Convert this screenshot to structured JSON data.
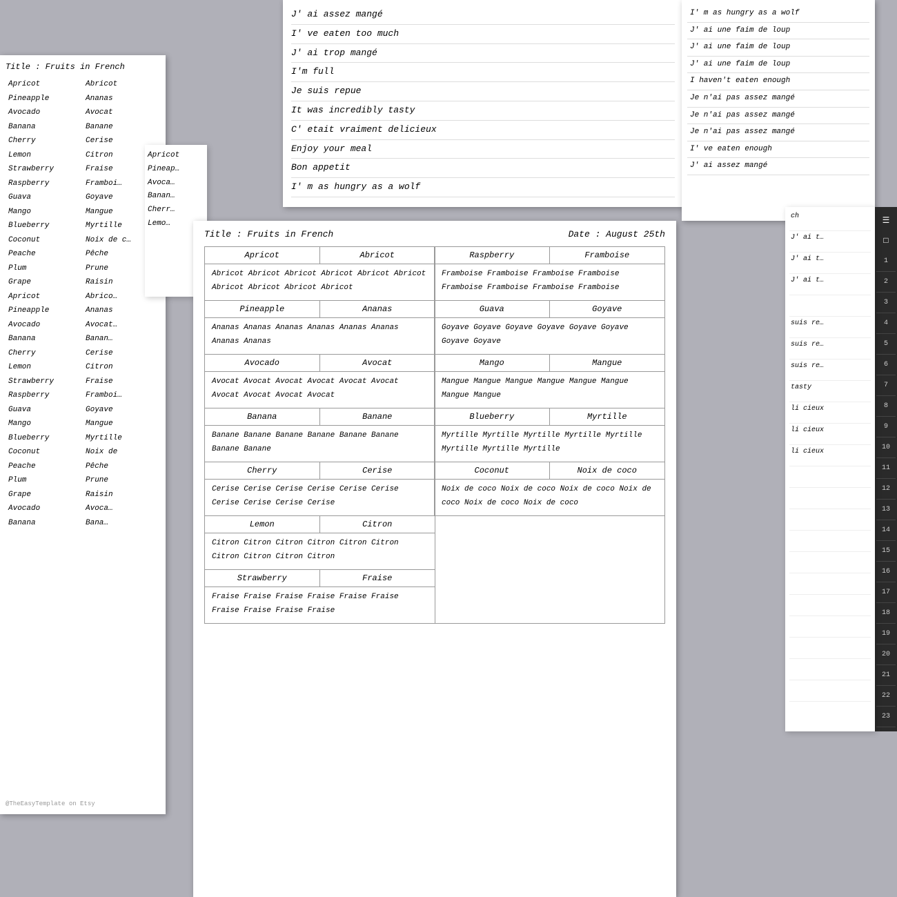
{
  "left_page": {
    "title": "Title : Fruits in French",
    "rows": [
      [
        "Apricot",
        "Abricot"
      ],
      [
        "Pineapple",
        "Ananas"
      ],
      [
        "Avocado",
        "Avocat"
      ],
      [
        "Banana",
        "Banane"
      ],
      [
        "Cherry",
        "Cerise"
      ],
      [
        "Lemon",
        "Citron"
      ],
      [
        "Strawberry",
        "Fraise"
      ],
      [
        "Raspberry",
        "Framboi…"
      ],
      [
        "Guava",
        "Goyave"
      ],
      [
        "Mango",
        "Mangue"
      ],
      [
        "Blueberry",
        "Myrtille"
      ],
      [
        "Coconut",
        "Noix de c…"
      ],
      [
        "Peache",
        "Pêche"
      ],
      [
        "Plum",
        "Prune"
      ],
      [
        "Grape",
        "Raisin"
      ],
      [
        "Apricot",
        "Abrico…"
      ],
      [
        "Pineapple",
        "Ananas"
      ],
      [
        "Avocado",
        "Avocat…"
      ],
      [
        "Banana",
        "Banan…"
      ],
      [
        "Cherry",
        "Cerise"
      ],
      [
        "Lemon",
        "Citron"
      ],
      [
        "Strawberry",
        "Fraise"
      ],
      [
        "Raspberry",
        "Framboi…"
      ],
      [
        "Guava",
        "Goyave"
      ],
      [
        "Mango",
        "Mangue"
      ],
      [
        "Blueberry",
        "Myrtille"
      ],
      [
        "Coconut",
        "Noix de"
      ],
      [
        "Peache",
        "Pêche"
      ],
      [
        "Plum",
        "Prune"
      ],
      [
        "Grape",
        "Raisin"
      ],
      [
        "Avocado",
        "Avoca…"
      ],
      [
        "Banana",
        "Bana…"
      ]
    ],
    "watermark": "@TheEasyTemplate on Etsy"
  },
  "left_col3": [
    "Apricot",
    "Pineap…",
    "Avoca…",
    "Banan…",
    "Cherr…",
    "Lemo…"
  ],
  "top_page": {
    "lines": [
      "J' ai assez mangé",
      "I' ve eaten too much",
      "J' ai trop mangé",
      "I'm full",
      "Je suis repue",
      "It was incredibly tasty",
      "C' etait vraiment delicieux",
      "Enjoy your meal",
      "Bon appetit",
      "I' m as hungry as a wolf"
    ]
  },
  "right_top_page": {
    "lines": [
      "I' m as hungry as a wolf",
      "J' ai une faim de loup",
      "J' ai une faim de loup",
      "J' ai une faim de loup",
      "I haven't eaten enough",
      "Je n'ai pas assez mangé",
      "Je n'ai pas assez mangé",
      "Je n'ai pas assez mangé",
      "I' ve eaten enough",
      "J' ai assez mangé"
    ]
  },
  "right_sidebar_lines": [
    "ch",
    "J' ai t…",
    "J' ai t…",
    "J' ai t…",
    "",
    "suis re…",
    "suis re…",
    "suis re…",
    "tasty",
    "li cieux",
    "li cieux",
    "li cieux",
    "",
    "",
    "",
    "",
    "",
    "",
    "",
    "",
    "",
    "",
    ""
  ],
  "toolbar": {
    "icons": [
      "☰",
      "□"
    ],
    "numbers": [
      "1",
      "2",
      "3",
      "4",
      "5",
      "6",
      "7",
      "8",
      "9",
      "10",
      "11",
      "12",
      "13",
      "14",
      "15",
      "16",
      "17",
      "18",
      "19",
      "20",
      "21",
      "22",
      "23"
    ]
  },
  "main_page": {
    "title": "Title : Fruits in French",
    "date": "Date : August 25th",
    "sections_left": [
      {
        "english": "Apricot",
        "french": "Abricot",
        "words": "Abricot  Abricot  Abricot  Abricot  Abricot\nAbricot  Abricot  Abricot  Abricot  Abricot"
      },
      {
        "english": "Pineapple",
        "french": "Ananas",
        "words": "Ananas  Ananas  Ananas  Ananas\nAnanas  Ananas  Ananas  Ananas"
      },
      {
        "english": "Avocado",
        "french": "Avocat",
        "words": "Avocat  Avocat  Avocat  Avocat  Avocat\nAvocat  Avocat  Avocat  Avocat  Avocat"
      },
      {
        "english": "Banana",
        "french": "Banane",
        "words": "Banane  Banane  Banane  Banane\nBanane  Banane  Banane  Banane"
      },
      {
        "english": "Cherry",
        "french": "Cerise",
        "words": "Cerise  Cerise  Cerise  Cerise  Cerise\nCerise  Cerise  Cerise  Cerise  Cerise"
      },
      {
        "english": "Lemon",
        "french": "Citron",
        "words": "Citron  Citron  Citron  Citron  Citron\nCitron  Citron  Citron  Citron  Citron"
      },
      {
        "english": "Strawberry",
        "french": "Fraise",
        "words": "Fraise  Fraise  Fraise  Fraise  Fraise\nFraise  Fraise  Fraise  Fraise  Fraise"
      }
    ],
    "sections_right": [
      {
        "english": "Raspberry",
        "french": "Framboise",
        "words": "Framboise  Framboise  Framboise  Framboise\nFramboise  Framboise  Framboise  Framboise"
      },
      {
        "english": "Guava",
        "french": "Goyave",
        "words": "Goyave  Goyave  Goyave  Goyave\nGoyave  Goyave  Goyave  Goyave"
      },
      {
        "english": "Mango",
        "french": "Mangue",
        "words": "Mangue  Mangue  Mangue  Mangue\nMangue  Mangue  Mangue  Mangue"
      },
      {
        "english": "Blueberry",
        "french": "Myrtille",
        "words": "Myrtille  Myrtille  Myrtille  Myrtille\nMyrtille  Myrtille  Myrtille  Myrtille"
      },
      {
        "english": "Coconut",
        "french": "Noix de coco",
        "words": "Noix de coco  Noix de coco  Noix de coco\nNoix de coco  Noix de coco  Noix de coco"
      }
    ]
  }
}
